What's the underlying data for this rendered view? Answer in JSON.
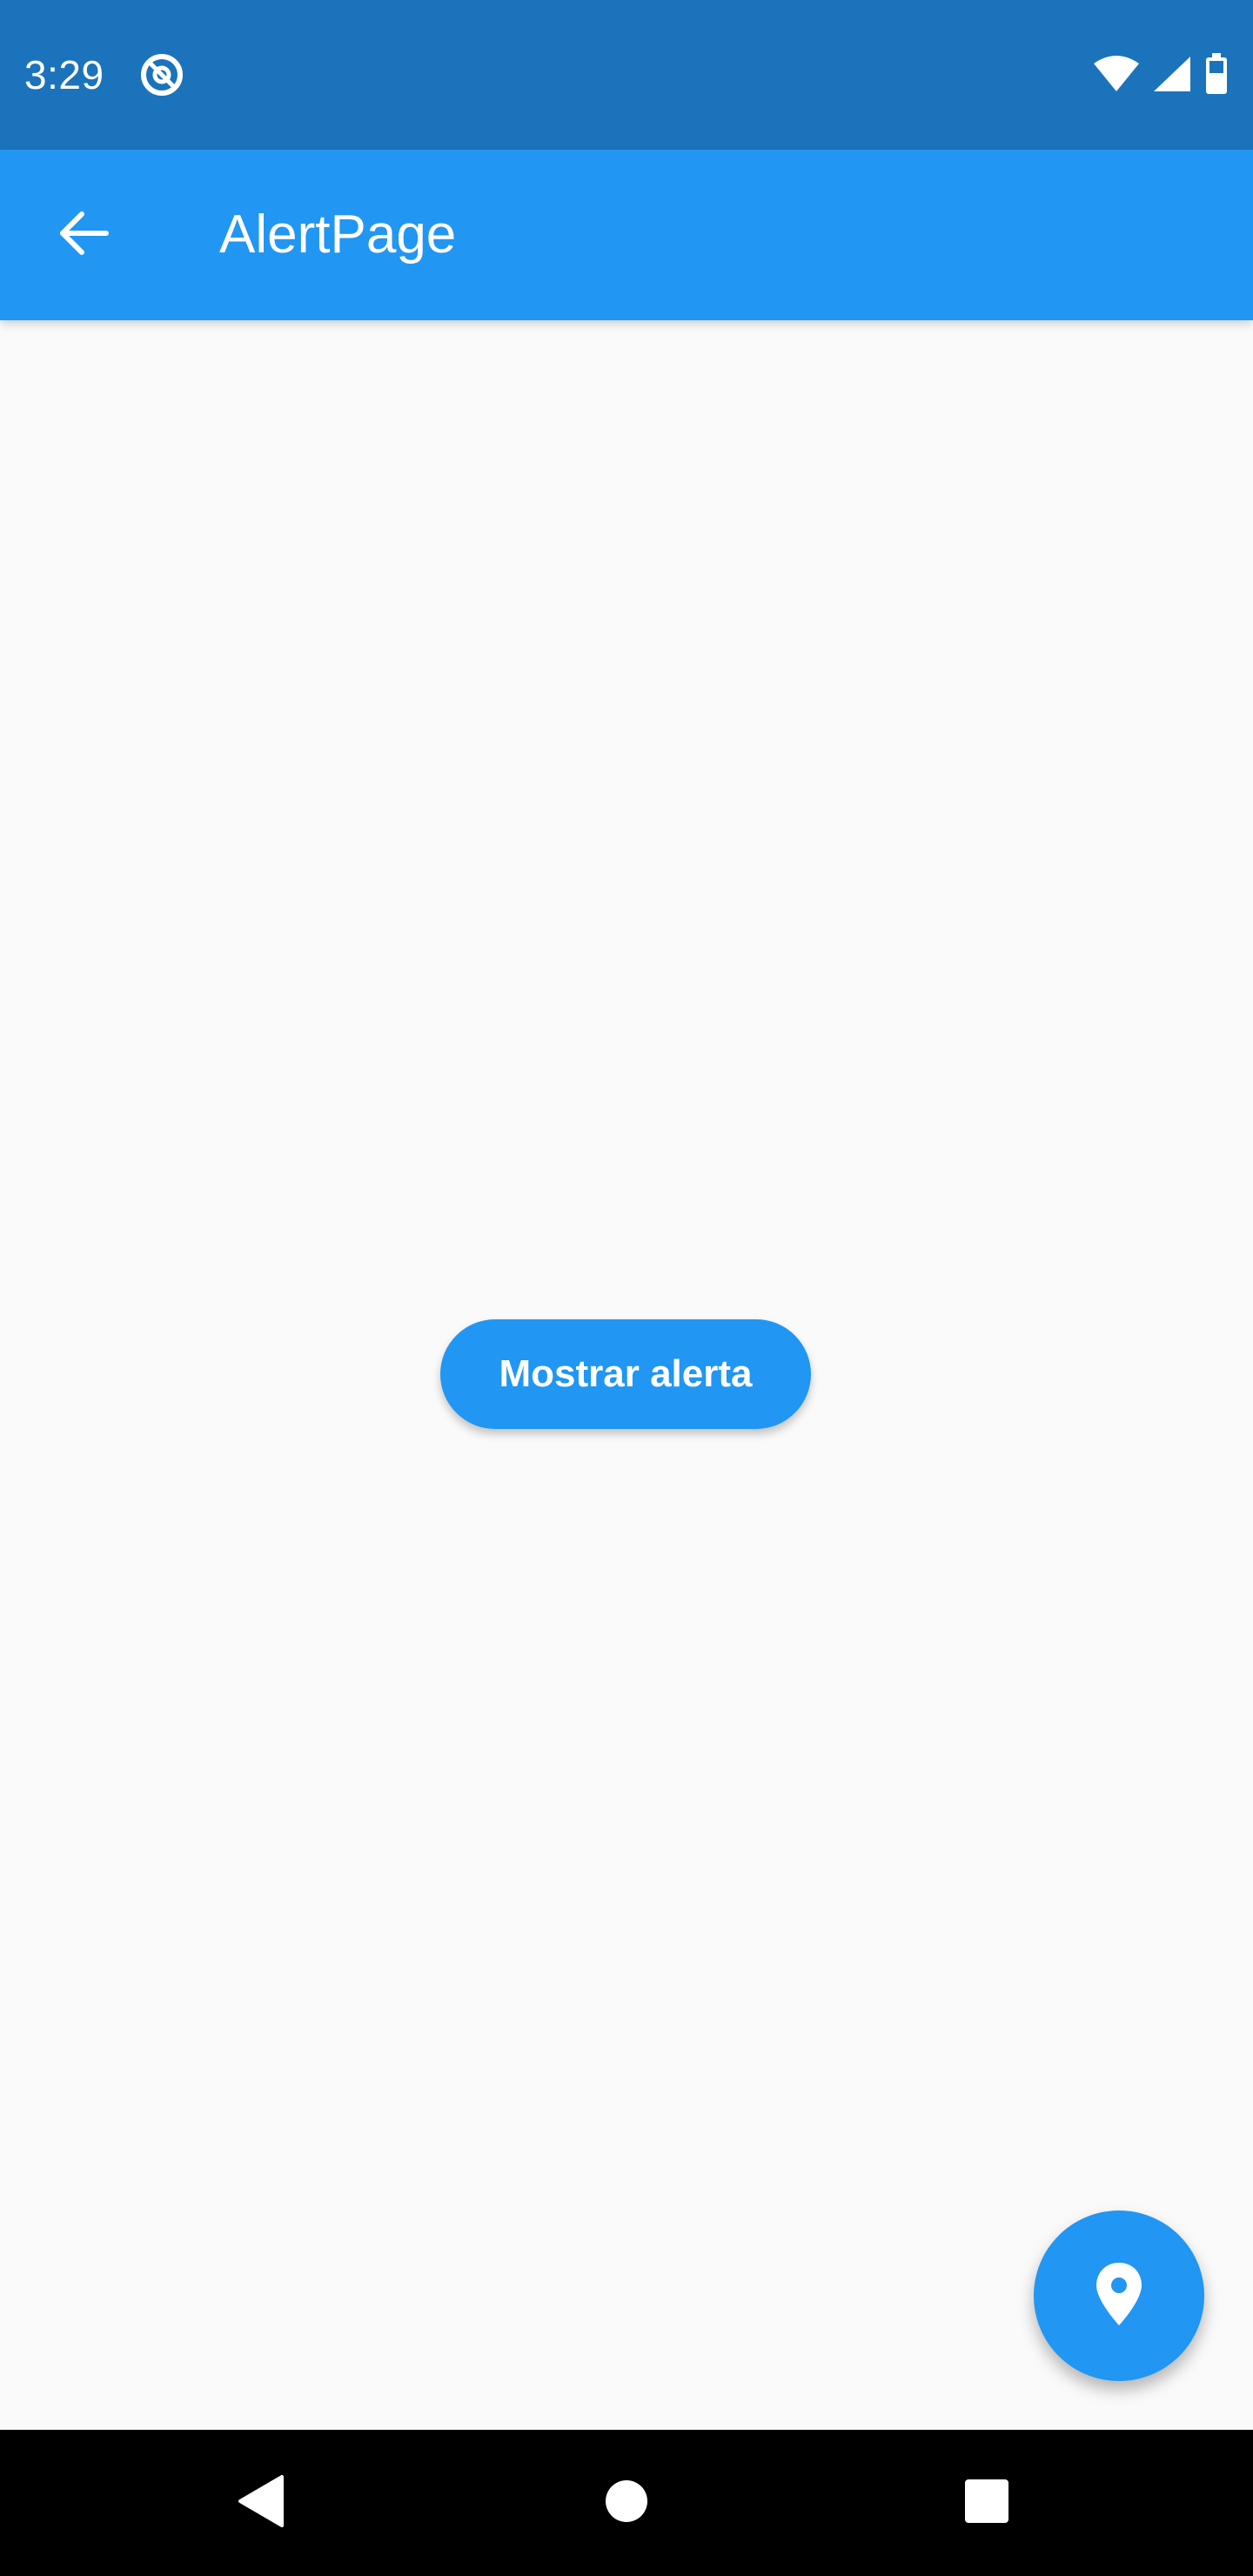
{
  "status_bar": {
    "time": "3:29",
    "icons": [
      "at-sign-icon",
      "wifi-icon",
      "signal-icon",
      "battery-icon"
    ]
  },
  "app_bar": {
    "back_icon": "arrow-back-icon",
    "title": "AlertPage"
  },
  "main": {
    "button_label": "Mostrar alerta"
  },
  "fab": {
    "icon": "location-pin-icon"
  },
  "nav_bar": {
    "icons": [
      "nav-back-icon",
      "nav-home-icon",
      "nav-recents-icon"
    ]
  },
  "colors": {
    "status_bar": "#1B73BB",
    "primary": "#2196F3",
    "background": "#FAFAFA",
    "nav_bar": "#000000",
    "on_primary": "#FFFFFF"
  }
}
